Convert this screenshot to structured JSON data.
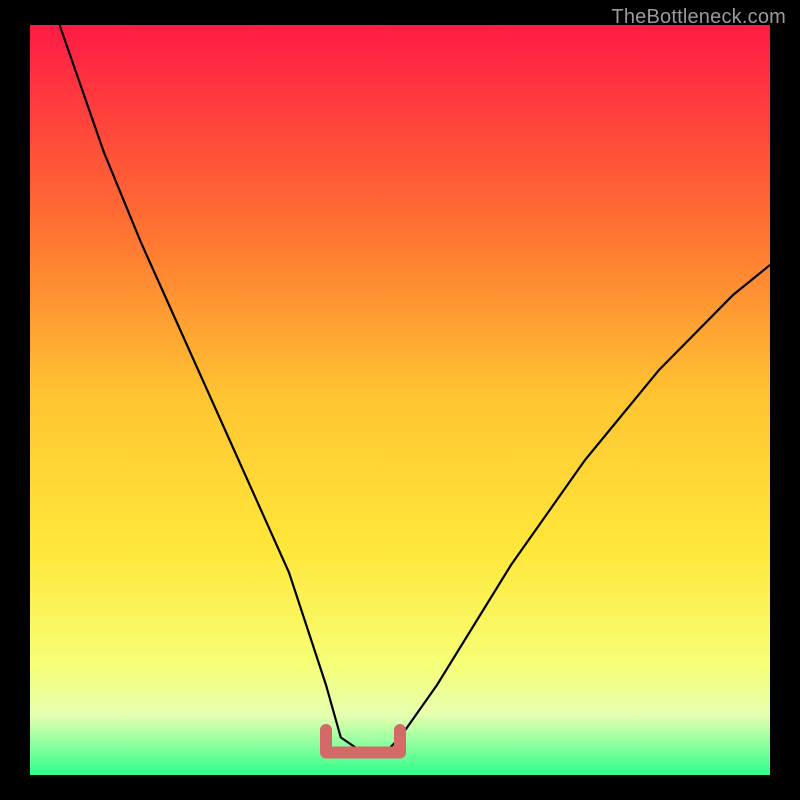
{
  "watermark": "TheBottleneck.com",
  "chart_data": {
    "type": "line",
    "title": "",
    "xlabel": "",
    "ylabel": "",
    "xlim": [
      0,
      100
    ],
    "ylim": [
      0,
      100
    ],
    "series": [
      {
        "name": "bottleneck-curve",
        "x": [
          4,
          10,
          15,
          20,
          25,
          30,
          35,
          40,
          42,
          45,
          48,
          50,
          55,
          60,
          65,
          70,
          75,
          80,
          85,
          90,
          95,
          100
        ],
        "y": [
          100,
          83,
          71,
          60,
          49,
          38,
          27,
          12,
          5,
          3,
          3,
          5,
          12,
          20,
          28,
          35,
          42,
          48,
          54,
          59,
          64,
          68
        ]
      }
    ],
    "optimal_range": {
      "x_from": 40,
      "x_to": 50,
      "y_low": 3,
      "y_high": 6
    },
    "gradient_stops": [
      {
        "pos": 0.0,
        "color": "#ff1b45"
      },
      {
        "pos": 0.25,
        "color": "#ff6a33"
      },
      {
        "pos": 0.5,
        "color": "#ffc631"
      },
      {
        "pos": 0.7,
        "color": "#ffe73a"
      },
      {
        "pos": 0.85,
        "color": "#f6ff75"
      },
      {
        "pos": 0.92,
        "color": "#e7ffb0"
      },
      {
        "pos": 1.0,
        "color": "#2eff8b"
      }
    ]
  }
}
